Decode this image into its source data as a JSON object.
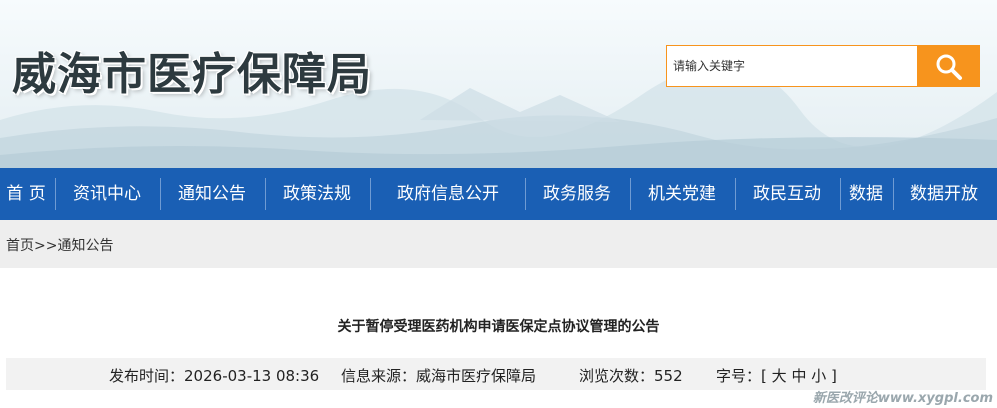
{
  "header": {
    "site_title": "威海市医疗保障局"
  },
  "search": {
    "placeholder": "请输入关键字",
    "button_icon": "search-icon"
  },
  "nav": {
    "items": [
      {
        "label": "首 页"
      },
      {
        "label": "资讯中心"
      },
      {
        "label": "通知公告"
      },
      {
        "label": "政策法规"
      },
      {
        "label": "政府信息公开"
      },
      {
        "label": "政务服务"
      },
      {
        "label": "机关党建"
      },
      {
        "label": "政民互动"
      },
      {
        "label": "数据"
      },
      {
        "label": "数据开放"
      }
    ]
  },
  "breadcrumb": {
    "home": "首页",
    "separator": ">>",
    "current": "通知公告"
  },
  "article": {
    "title": "关于暂停受理医药机构申请医保定点协议管理的公告",
    "publish_label": "发布时间：",
    "publish_time": "2026-03-13 08:36",
    "source_label": "信息来源：",
    "source": "威海市医疗保障局",
    "views_label": "浏览次数：",
    "views": "552",
    "fontsize_label": "字号：",
    "fontsize_open": "[",
    "fontsize_large": "大",
    "fontsize_medium": "中",
    "fontsize_small": "小",
    "fontsize_close": "]"
  },
  "watermark": "新医改评论www.xygpl.com",
  "colors": {
    "nav_bg": "#1a5fb4",
    "search_accent": "#f7941d",
    "breadcrumb_bg": "#eeeeee"
  }
}
